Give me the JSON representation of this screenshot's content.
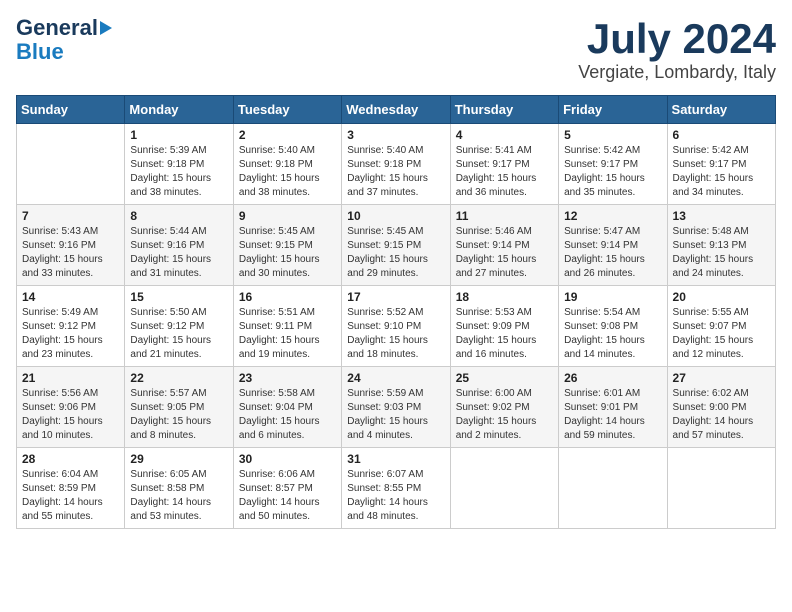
{
  "logo": {
    "line1": "General",
    "line2": "Blue"
  },
  "header": {
    "month_year": "July 2024",
    "location": "Vergiate, Lombardy, Italy"
  },
  "weekdays": [
    "Sunday",
    "Monday",
    "Tuesday",
    "Wednesday",
    "Thursday",
    "Friday",
    "Saturday"
  ],
  "weeks": [
    [
      {
        "day": "",
        "sunrise": "",
        "sunset": "",
        "daylight": ""
      },
      {
        "day": "1",
        "sunrise": "5:39 AM",
        "sunset": "9:18 PM",
        "daylight": "15 hours and 38 minutes."
      },
      {
        "day": "2",
        "sunrise": "5:40 AM",
        "sunset": "9:18 PM",
        "daylight": "15 hours and 38 minutes."
      },
      {
        "day": "3",
        "sunrise": "5:40 AM",
        "sunset": "9:18 PM",
        "daylight": "15 hours and 37 minutes."
      },
      {
        "day": "4",
        "sunrise": "5:41 AM",
        "sunset": "9:17 PM",
        "daylight": "15 hours and 36 minutes."
      },
      {
        "day": "5",
        "sunrise": "5:42 AM",
        "sunset": "9:17 PM",
        "daylight": "15 hours and 35 minutes."
      },
      {
        "day": "6",
        "sunrise": "5:42 AM",
        "sunset": "9:17 PM",
        "daylight": "15 hours and 34 minutes."
      }
    ],
    [
      {
        "day": "7",
        "sunrise": "5:43 AM",
        "sunset": "9:16 PM",
        "daylight": "15 hours and 33 minutes."
      },
      {
        "day": "8",
        "sunrise": "5:44 AM",
        "sunset": "9:16 PM",
        "daylight": "15 hours and 31 minutes."
      },
      {
        "day": "9",
        "sunrise": "5:45 AM",
        "sunset": "9:15 PM",
        "daylight": "15 hours and 30 minutes."
      },
      {
        "day": "10",
        "sunrise": "5:45 AM",
        "sunset": "9:15 PM",
        "daylight": "15 hours and 29 minutes."
      },
      {
        "day": "11",
        "sunrise": "5:46 AM",
        "sunset": "9:14 PM",
        "daylight": "15 hours and 27 minutes."
      },
      {
        "day": "12",
        "sunrise": "5:47 AM",
        "sunset": "9:14 PM",
        "daylight": "15 hours and 26 minutes."
      },
      {
        "day": "13",
        "sunrise": "5:48 AM",
        "sunset": "9:13 PM",
        "daylight": "15 hours and 24 minutes."
      }
    ],
    [
      {
        "day": "14",
        "sunrise": "5:49 AM",
        "sunset": "9:12 PM",
        "daylight": "15 hours and 23 minutes."
      },
      {
        "day": "15",
        "sunrise": "5:50 AM",
        "sunset": "9:12 PM",
        "daylight": "15 hours and 21 minutes."
      },
      {
        "day": "16",
        "sunrise": "5:51 AM",
        "sunset": "9:11 PM",
        "daylight": "15 hours and 19 minutes."
      },
      {
        "day": "17",
        "sunrise": "5:52 AM",
        "sunset": "9:10 PM",
        "daylight": "15 hours and 18 minutes."
      },
      {
        "day": "18",
        "sunrise": "5:53 AM",
        "sunset": "9:09 PM",
        "daylight": "15 hours and 16 minutes."
      },
      {
        "day": "19",
        "sunrise": "5:54 AM",
        "sunset": "9:08 PM",
        "daylight": "15 hours and 14 minutes."
      },
      {
        "day": "20",
        "sunrise": "5:55 AM",
        "sunset": "9:07 PM",
        "daylight": "15 hours and 12 minutes."
      }
    ],
    [
      {
        "day": "21",
        "sunrise": "5:56 AM",
        "sunset": "9:06 PM",
        "daylight": "15 hours and 10 minutes."
      },
      {
        "day": "22",
        "sunrise": "5:57 AM",
        "sunset": "9:05 PM",
        "daylight": "15 hours and 8 minutes."
      },
      {
        "day": "23",
        "sunrise": "5:58 AM",
        "sunset": "9:04 PM",
        "daylight": "15 hours and 6 minutes."
      },
      {
        "day": "24",
        "sunrise": "5:59 AM",
        "sunset": "9:03 PM",
        "daylight": "15 hours and 4 minutes."
      },
      {
        "day": "25",
        "sunrise": "6:00 AM",
        "sunset": "9:02 PM",
        "daylight": "15 hours and 2 minutes."
      },
      {
        "day": "26",
        "sunrise": "6:01 AM",
        "sunset": "9:01 PM",
        "daylight": "14 hours and 59 minutes."
      },
      {
        "day": "27",
        "sunrise": "6:02 AM",
        "sunset": "9:00 PM",
        "daylight": "14 hours and 57 minutes."
      }
    ],
    [
      {
        "day": "28",
        "sunrise": "6:04 AM",
        "sunset": "8:59 PM",
        "daylight": "14 hours and 55 minutes."
      },
      {
        "day": "29",
        "sunrise": "6:05 AM",
        "sunset": "8:58 PM",
        "daylight": "14 hours and 53 minutes."
      },
      {
        "day": "30",
        "sunrise": "6:06 AM",
        "sunset": "8:57 PM",
        "daylight": "14 hours and 50 minutes."
      },
      {
        "day": "31",
        "sunrise": "6:07 AM",
        "sunset": "8:55 PM",
        "daylight": "14 hours and 48 minutes."
      },
      {
        "day": "",
        "sunrise": "",
        "sunset": "",
        "daylight": ""
      },
      {
        "day": "",
        "sunrise": "",
        "sunset": "",
        "daylight": ""
      },
      {
        "day": "",
        "sunrise": "",
        "sunset": "",
        "daylight": ""
      }
    ]
  ]
}
